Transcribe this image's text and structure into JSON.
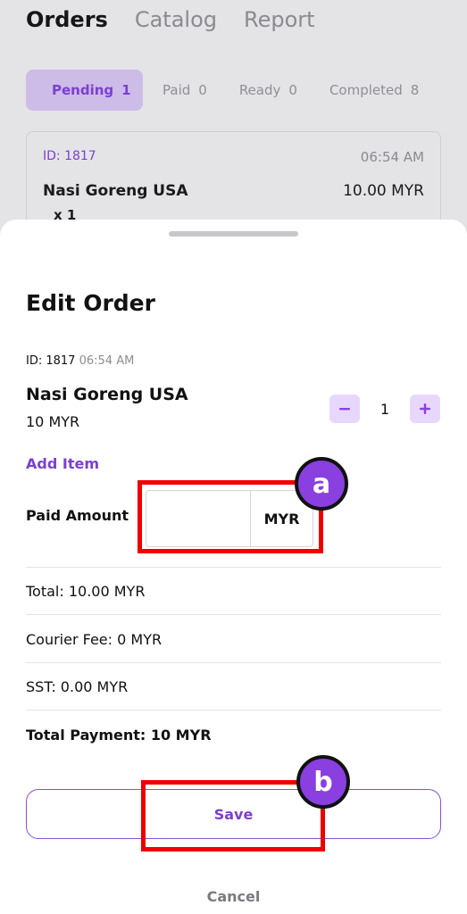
{
  "top_tabs": [
    "Orders",
    "Catalog",
    "Report"
  ],
  "status_tabs": [
    {
      "label": "Pending",
      "count": "1"
    },
    {
      "label": "Paid",
      "count": "0"
    },
    {
      "label": "Ready",
      "count": "0"
    },
    {
      "label": "Completed",
      "count": "8"
    }
  ],
  "bg_order": {
    "id": "ID: 1817",
    "time": "06:54 AM",
    "name": "Nasi Goreng USA",
    "price": "10.00 MYR",
    "qty": "x 1"
  },
  "sheet": {
    "title": "Edit Order",
    "order_id": "ID: 1817",
    "order_time": "06:54 AM",
    "item": {
      "name": "Nasi Goreng USA",
      "price": "10 MYR",
      "quantity": "1"
    },
    "add_item_label": "Add Item",
    "paid_amount_label": "Paid Amount",
    "paid_amount_value": "",
    "paid_amount_unit": "MYR",
    "total": "Total: 10.00 MYR",
    "courier_fee": "Courier Fee: 0 MYR",
    "sst": "SST: 0.00 MYR",
    "total_payment": "Total Payment: 10 MYR",
    "save_label": "Save",
    "cancel_label": "Cancel"
  },
  "annotations": {
    "a": "a",
    "b": "b"
  },
  "colors": {
    "accent": "#7c3fd1",
    "highlight": "#ee0000",
    "marker": "#8a3fe0"
  }
}
